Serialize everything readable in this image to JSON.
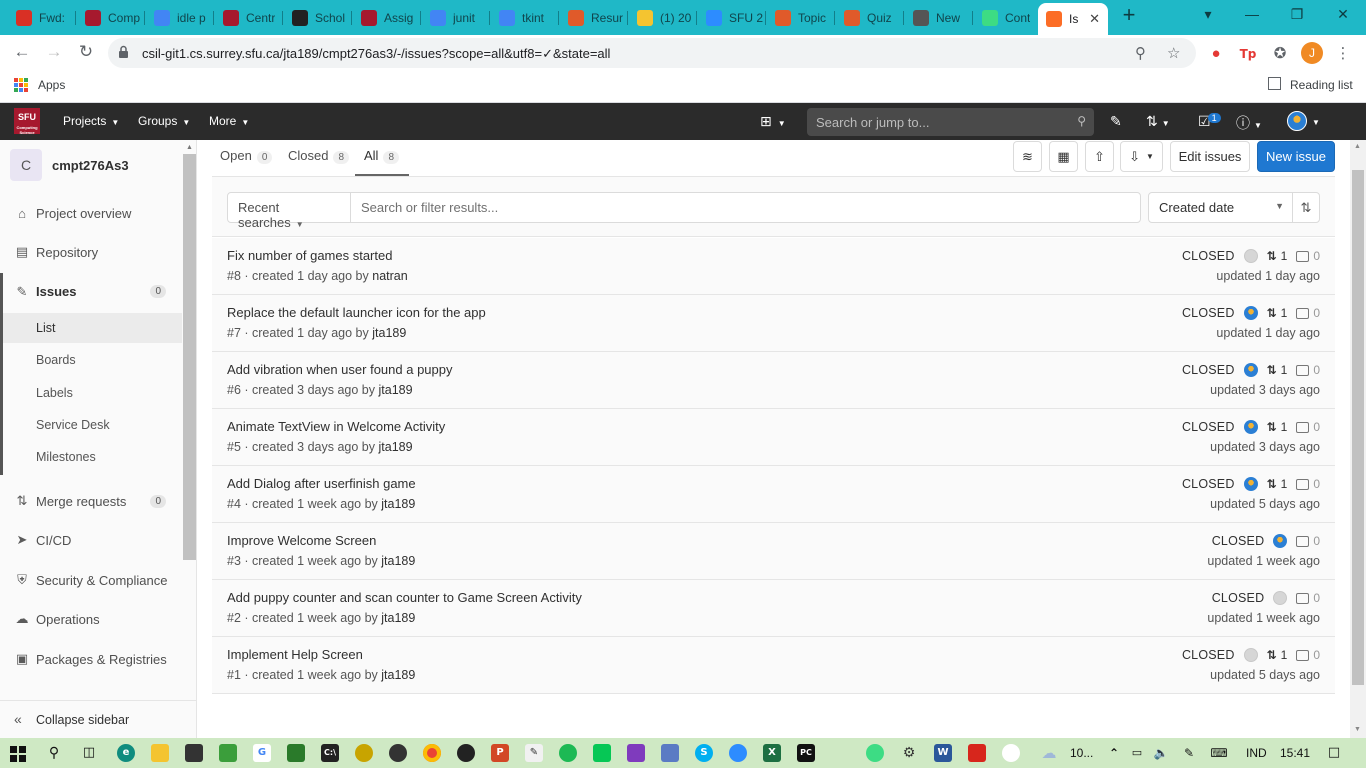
{
  "browser": {
    "tabs": [
      {
        "title": "Fwd:",
        "icon": "gmail-icon",
        "color": "#d93025"
      },
      {
        "title": "Comp",
        "icon": "sfu-icon",
        "color": "#a6192e"
      },
      {
        "title": "idle p",
        "icon": "google-icon",
        "color": "#4285f4"
      },
      {
        "title": "Centr",
        "icon": "sfu-icon",
        "color": "#a6192e"
      },
      {
        "title": "Schol",
        "icon": "grid-icon",
        "color": "#222222"
      },
      {
        "title": "Assig",
        "icon": "course-276-icon",
        "color": "#a6192e"
      },
      {
        "title": "junit",
        "icon": "google-icon",
        "color": "#4285f4"
      },
      {
        "title": "tkint",
        "icon": "google-icon",
        "color": "#4285f4"
      },
      {
        "title": "Resur",
        "icon": "ring-icon",
        "color": "#e05a2a"
      },
      {
        "title": "(1) 20",
        "icon": "moon-icon",
        "color": "#f4c430"
      },
      {
        "title": "SFU 2",
        "icon": "zoom-icon",
        "color": "#2d8cff"
      },
      {
        "title": "Topic",
        "icon": "ring-icon",
        "color": "#e05a2a"
      },
      {
        "title": "Quiz",
        "icon": "ring-icon",
        "color": "#e05a2a"
      },
      {
        "title": "New",
        "icon": "chrome-icon",
        "color": "#555555"
      },
      {
        "title": "Cont",
        "icon": "android-icon",
        "color": "#3ddc84"
      },
      {
        "title": "Is",
        "icon": "gitlab-icon",
        "color": "#fc6d26",
        "active": true
      }
    ],
    "url": "csil-git1.cs.surrey.sfu.ca/jta189/cmpt276as3/-/issues?scope=all&utf8=✓&state=all",
    "profile_initial": "J",
    "bookmarks": {
      "apps_label": "Apps",
      "reading_list_label": "Reading list"
    }
  },
  "header": {
    "logo_text": "SFU",
    "logo_subtext": "Computing Science",
    "nav": [
      "Projects",
      "Groups",
      "More"
    ],
    "search_placeholder": "Search or jump to...",
    "todo_count": "1"
  },
  "sidebar": {
    "project_initial": "C",
    "project_name": "cmpt276As3",
    "items": [
      {
        "label": "Project overview",
        "icon": "home-icon"
      },
      {
        "label": "Repository",
        "icon": "book-icon"
      },
      {
        "label": "Issues",
        "icon": "issues-icon",
        "count": "0"
      },
      {
        "label": "Merge requests",
        "icon": "merge-request-icon",
        "count": "0"
      },
      {
        "label": "CI/CD",
        "icon": "rocket-icon"
      },
      {
        "label": "Security & Compliance",
        "icon": "shield-icon"
      },
      {
        "label": "Operations",
        "icon": "cloud-gear-icon"
      },
      {
        "label": "Packages & Registries",
        "icon": "package-icon"
      }
    ],
    "issue_subitems": [
      "List",
      "Boards",
      "Labels",
      "Service Desk",
      "Milestones"
    ],
    "collapse_label": "Collapse sidebar"
  },
  "main": {
    "state_tabs": [
      {
        "label": "Open",
        "count": "0"
      },
      {
        "label": "Closed",
        "count": "8"
      },
      {
        "label": "All",
        "count": "8",
        "active": true
      }
    ],
    "edit_issues_label": "Edit issues",
    "new_issue_label": "New issue",
    "recent_searches_label": "Recent searches",
    "filter_placeholder": "Search or filter results...",
    "sort_label": "Created date",
    "issues": [
      {
        "title": "Fix number of games started",
        "ref": "#8",
        "created": "created 1 day ago by",
        "author": "natran",
        "status": "CLOSED",
        "assignee": "grey",
        "mrs": "1",
        "comments": "0",
        "updated": "updated 1 day ago"
      },
      {
        "title": "Replace the default launcher icon for the app",
        "ref": "#7",
        "created": "created 1 day ago by",
        "author": "jta189",
        "status": "CLOSED",
        "assignee": "blue",
        "mrs": "1",
        "comments": "0",
        "updated": "updated 1 day ago"
      },
      {
        "title": "Add vibration when user found a puppy",
        "ref": "#6",
        "created": "created 3 days ago by",
        "author": "jta189",
        "status": "CLOSED",
        "assignee": "blue",
        "mrs": "1",
        "comments": "0",
        "updated": "updated 3 days ago"
      },
      {
        "title": "Animate TextView in Welcome Activity",
        "ref": "#5",
        "created": "created 3 days ago by",
        "author": "jta189",
        "status": "CLOSED",
        "assignee": "blue",
        "mrs": "1",
        "comments": "0",
        "updated": "updated 3 days ago"
      },
      {
        "title": "Add Dialog after userfinish game",
        "ref": "#4",
        "created": "created 1 week ago by",
        "author": "jta189",
        "status": "CLOSED",
        "assignee": "blue",
        "mrs": "1",
        "comments": "0",
        "updated": "updated 5 days ago"
      },
      {
        "title": "Improve Welcome Screen",
        "ref": "#3",
        "created": "created 1 week ago by",
        "author": "jta189",
        "status": "CLOSED",
        "assignee": "blue",
        "mrs": "",
        "comments": "0",
        "updated": "updated 1 week ago"
      },
      {
        "title": "Add puppy counter and scan counter to Game Screen Activity",
        "ref": "#2",
        "created": "created 1 week ago by",
        "author": "jta189",
        "status": "CLOSED",
        "assignee": "grey",
        "mrs": "",
        "comments": "0",
        "updated": "updated 1 week ago"
      },
      {
        "title": "Implement Help Screen",
        "ref": "#1",
        "created": "created 1 week ago by",
        "author": "jta189",
        "status": "CLOSED",
        "assignee": "grey",
        "mrs": "1",
        "comments": "0",
        "updated": "updated 5 days ago"
      }
    ]
  },
  "taskbar": {
    "weather": "10...",
    "language": "IND",
    "time": "15:41"
  }
}
